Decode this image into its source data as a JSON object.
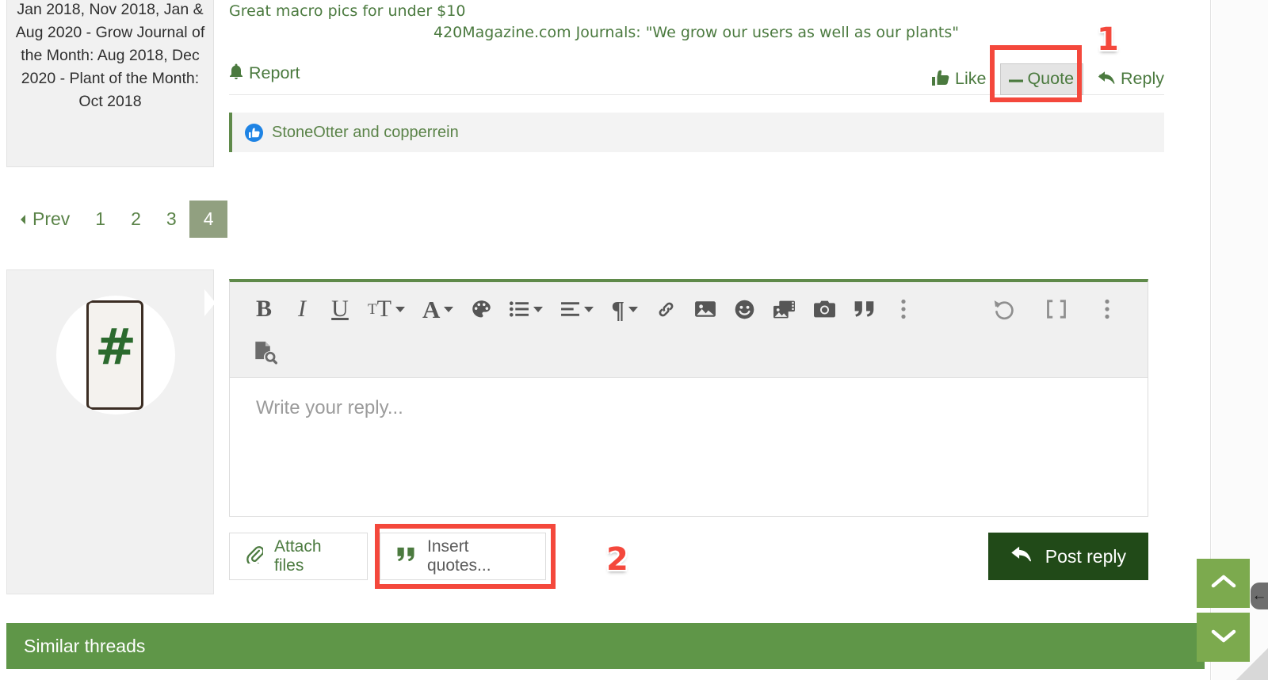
{
  "post": {
    "sidebar_text": "Jan 2018, Nov 2018, Jan & Aug 2020 - Grow Journal of the Month: Aug 2018, Dec 2020 - Plant of the Month: Oct 2018",
    "signature_line1": "Great macro pics for under $10",
    "signature_line2": "420Magazine.com Journals: \"We grow our users as well as our plants\"",
    "actions": {
      "report": "Report",
      "like": "Like",
      "quote": "Quote",
      "reply": "Reply"
    },
    "reactions": {
      "icon": "thumbs-up-icon",
      "names": "StoneOtter and copperrein"
    }
  },
  "pagination": {
    "prev": "Prev",
    "pages": [
      "1",
      "2",
      "3",
      "4"
    ],
    "active": "4"
  },
  "editor": {
    "placeholder": "Write your reply...",
    "toolbar_row1": [
      {
        "name": "bold-icon",
        "glyph": "B",
        "caret": false
      },
      {
        "name": "italic-icon",
        "glyph": "I",
        "caret": false
      },
      {
        "name": "underline-icon",
        "glyph": "U",
        "caret": false
      },
      {
        "name": "font-size-icon",
        "glyph": "TT",
        "caret": true
      },
      {
        "name": "font-family-icon",
        "glyph": "A",
        "caret": true
      },
      {
        "name": "text-color-palette-icon",
        "glyph": "palette",
        "caret": false
      },
      {
        "name": "bullet-list-icon",
        "glyph": "list",
        "caret": true
      },
      {
        "name": "align-icon",
        "glyph": "align",
        "caret": true
      },
      {
        "name": "paragraph-icon",
        "glyph": "¶",
        "caret": true
      },
      {
        "name": "link-icon",
        "glyph": "link",
        "caret": false
      },
      {
        "name": "image-icon",
        "glyph": "image",
        "caret": false
      },
      {
        "name": "emoji-icon",
        "glyph": "smiley",
        "caret": false
      },
      {
        "name": "media-gallery-icon",
        "glyph": "gallery",
        "caret": false
      },
      {
        "name": "camera-icon",
        "glyph": "camera",
        "caret": false
      },
      {
        "name": "blockquote-icon",
        "glyph": "quote",
        "caret": false
      },
      {
        "name": "more-options-icon",
        "glyph": "dots",
        "caret": false
      }
    ],
    "toolbar_right": [
      {
        "name": "undo-icon",
        "glyph": "undo"
      },
      {
        "name": "bbcode-icon",
        "glyph": "brackets"
      },
      {
        "name": "toolbar-overflow-icon",
        "glyph": "dots"
      }
    ],
    "toolbar_row2": [
      {
        "name": "preview-document-icon",
        "glyph": "doc-search"
      }
    ]
  },
  "buttons": {
    "attach_files": "Attach files",
    "insert_quotes": "Insert quotes...",
    "post_reply": "Post reply"
  },
  "annotations": {
    "badge_1": "1",
    "badge_2": "2"
  },
  "footer": {
    "similar_threads": "Similar threads"
  },
  "scroll": {
    "up_icon": "chevron-up-icon",
    "down_icon": "chevron-down-icon",
    "edge_handle_icon": "arrow-left-icon"
  },
  "colors": {
    "link_green": "#4b7a3f",
    "brand_green": "#5f9648",
    "dark_green": "#214a18",
    "accent_red": "#f4483c",
    "active_page": "#91a080"
  }
}
